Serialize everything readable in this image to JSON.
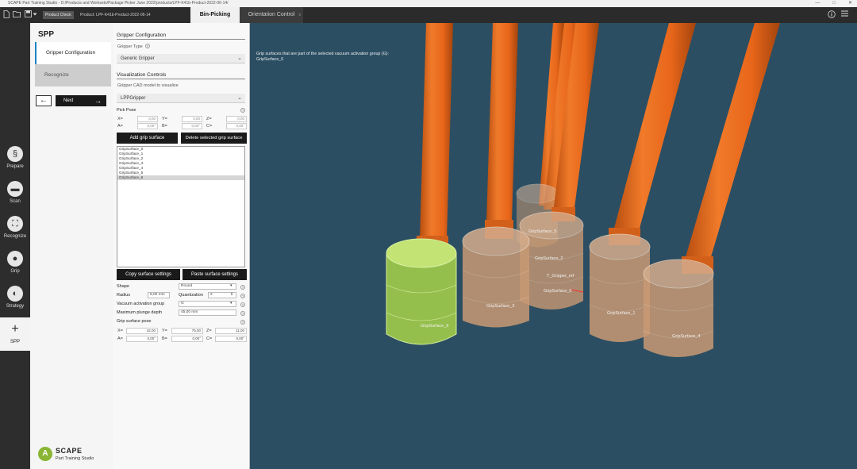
{
  "window": {
    "title": "SCAPE Part Training Studio - D:/Products and Worksets/Package Picker June 2022/products/LPF-K41b-Product-2022-06-14/",
    "controls": [
      "—",
      "□",
      "✕"
    ]
  },
  "toolbar": {
    "product_check_label": "Product Check",
    "product_value": "Product: LPF-K41b-Product-2022-06-14",
    "icons": [
      "new-file-icon",
      "open-folder-icon",
      "save-icon",
      "dropdown-icon"
    ],
    "right_icons": [
      "info-icon",
      "menu-icon"
    ]
  },
  "tabs": [
    {
      "label": "Bin-Picking",
      "active": true
    },
    {
      "label": "Orientation Control",
      "active": false,
      "close": "x"
    }
  ],
  "left_nav": [
    {
      "label": "Prepare",
      "icon": "prepare-icon",
      "glyph": "§"
    },
    {
      "label": "Scan",
      "icon": "scan-icon",
      "glyph": "▬"
    },
    {
      "label": "Recognize",
      "icon": "recognize-icon",
      "glyph": "⛶"
    },
    {
      "label": "Grip",
      "icon": "grip-icon",
      "glyph": "●"
    },
    {
      "label": "Strategy",
      "icon": "strategy-icon",
      "glyph": "◐"
    },
    {
      "label": "SPP",
      "icon": "plus-icon",
      "glyph": "+",
      "active": true
    }
  ],
  "steps": {
    "title": "SPP",
    "items": [
      "Gripper Configuration",
      "Recognize"
    ],
    "back_glyph": "←",
    "next_label": "Next",
    "next_glyph": "→"
  },
  "logo": {
    "mark": "A",
    "name": "SCAPE",
    "subtitle": "Part Training Studio"
  },
  "panel": {
    "gripper_config_title": "Gripper Configuration",
    "gripper_type_label": "Gripper Type",
    "gripper_type_value": "Generic Gripper",
    "viz_title": "Visualization Controls",
    "cad_label": "Gripper CAD model to visualize",
    "cad_value": "LPPGripper",
    "pick_pose_label": "Pick Pose",
    "pick_pose": {
      "x": "0,00",
      "y": "0,00",
      "z": "0,00",
      "a": "0,00°",
      "b": "0,00°",
      "c": "0,00°"
    },
    "add_button": "Add grip surface",
    "delete_button": "Delete selected grip surface",
    "surfaces": [
      "GripSurface_0",
      "GripSurface_1",
      "GripSurface_2",
      "GripSurface_3",
      "GripSurface_4",
      "GripSurface_5",
      "GripSurface_6"
    ],
    "copy_button": "Copy surface settings",
    "paste_button": "Paste surface settings",
    "shape_label": "Shape",
    "shape_value": "Round",
    "radius_label": "Radius",
    "radius_value": "8,00 mm",
    "quant_label": "Quantization",
    "quant_value": "2",
    "vacuum_label": "Vacuum activation group",
    "vacuum_value": "G",
    "plunge_label": "Maximum plunge depth",
    "plunge_value": "45,00 mm",
    "grip_pose_label": "Grip surface pose",
    "grip_pose": {
      "x": "42,00",
      "y": "75,00",
      "z": "11,00",
      "a": "0,00°",
      "b": "0,00°",
      "c": "0,00°"
    },
    "help_glyph": "?",
    "chevron": "⌄"
  },
  "viewport": {
    "info_line1": "Grip surfaces that are part of the selected vacuum activation group (G):",
    "info_line2": "GripSurface_6",
    "labels": [
      "GripSurface_5",
      "GripSurface_2",
      "T_Gripper_ref",
      "GripSurface_0",
      "GripSurface_3",
      "GripSurface_6",
      "GripSurface_1",
      "GripSurface_4"
    ],
    "colors": {
      "background": "#2c4e62",
      "rod": "#e8661a",
      "rod_shadow": "#b84e10",
      "cup_selected": "#a8d44a",
      "cup_selected_edge": "#d6f0a0",
      "cup": "#c99a74",
      "cup_edge": "#e9d6c6"
    }
  }
}
